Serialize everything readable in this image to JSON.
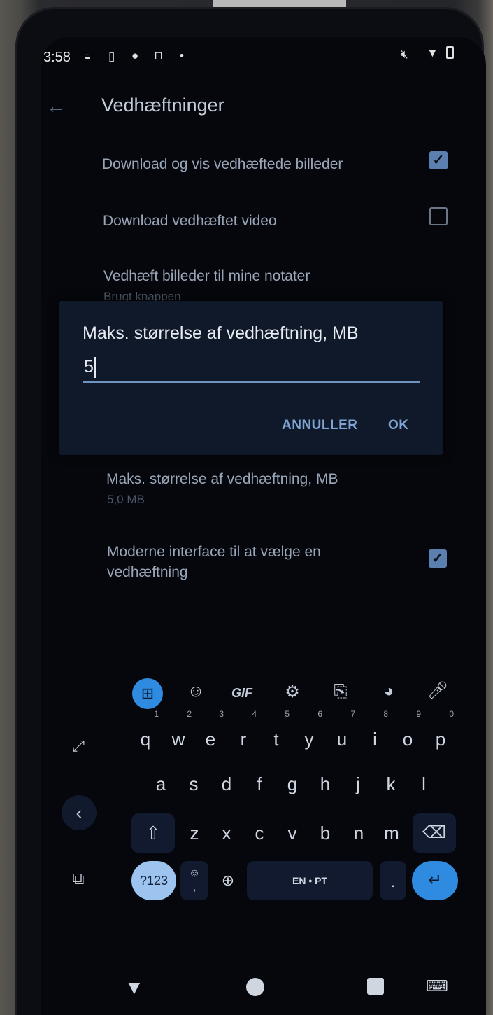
{
  "status": {
    "time": "3:58"
  },
  "header": {
    "title": "Vedhæftninger"
  },
  "prefs": [
    {
      "label": "Download og vis vedhæftede billeder",
      "checked": true
    },
    {
      "label": "Download vedhæftet video",
      "checked": false
    },
    {
      "label": "Vedhæft billeder til mine notater",
      "sub": "Brugt knappen"
    },
    {
      "label": "Maks. størrelse af vedhæftning, MB",
      "sub": "5,0 MB"
    },
    {
      "label_line1": "Moderne interface til at vælge en",
      "label_line2": "vedhæftning",
      "checked": true
    }
  ],
  "dialog": {
    "title": "Maks. størrelse af vedhæftning, MB",
    "value": "5",
    "cancel_label": "ANNULLER",
    "ok_label": "OK"
  },
  "keyboard": {
    "toolbar": {
      "gif_label": "GIF"
    },
    "row1": [
      {
        "k": "q",
        "n": "1"
      },
      {
        "k": "w",
        "n": "2"
      },
      {
        "k": "e",
        "n": "3"
      },
      {
        "k": "r",
        "n": "4"
      },
      {
        "k": "t",
        "n": "5"
      },
      {
        "k": "y",
        "n": "6"
      },
      {
        "k": "u",
        "n": "7"
      },
      {
        "k": "i",
        "n": "8"
      },
      {
        "k": "o",
        "n": "9"
      },
      {
        "k": "p",
        "n": "0"
      }
    ],
    "row2": [
      "a",
      "s",
      "d",
      "f",
      "g",
      "h",
      "j",
      "k",
      "l"
    ],
    "row3": [
      "z",
      "x",
      "c",
      "v",
      "b",
      "n",
      "m"
    ],
    "symbols_label": "?123",
    "space_label": "EN • PT",
    "period_label": "."
  },
  "colors": {
    "accent": "#2e8be0",
    "background": "#05070c",
    "dialog": "#10192a"
  }
}
